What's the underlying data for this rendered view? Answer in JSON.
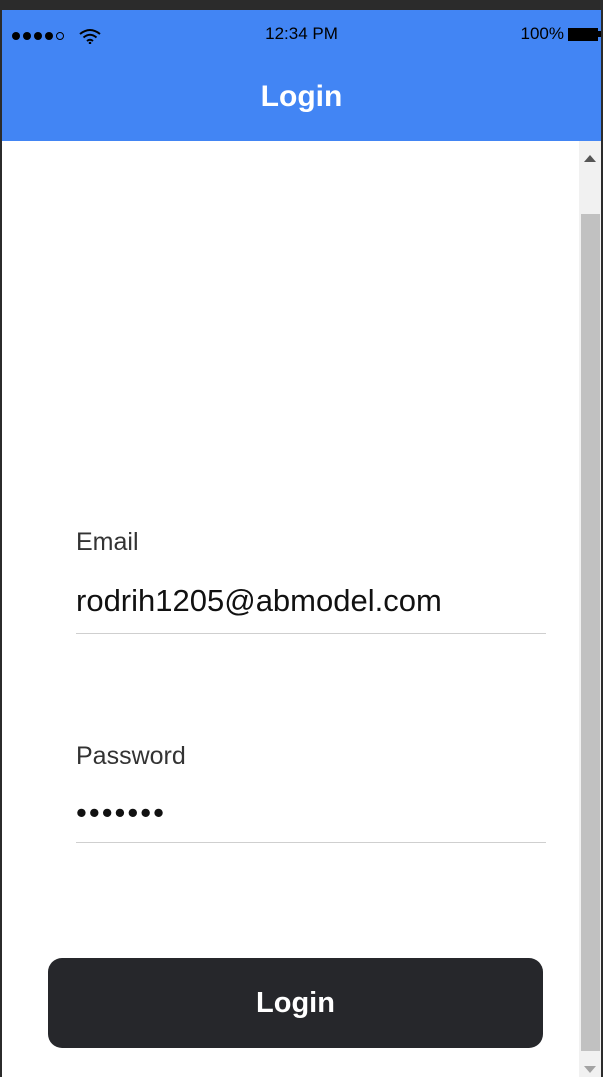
{
  "status_bar": {
    "time": "12:34 PM",
    "battery": "100%",
    "signal_icon": "signal-dots-icon",
    "wifi_icon": "wifi-icon",
    "battery_icon": "battery-icon"
  },
  "header": {
    "title": "Login",
    "background_color": "#4285f4"
  },
  "form": {
    "email": {
      "label": "Email",
      "value": "rodrih1205@abmodel.com"
    },
    "password": {
      "label": "Password",
      "value": "•••••••"
    },
    "login_button": {
      "label": "Login",
      "color": "#26272b"
    }
  },
  "scrollbar": {
    "up_icon": "scroll-up-arrow-icon",
    "down_icon": "scroll-down-arrow-icon"
  }
}
